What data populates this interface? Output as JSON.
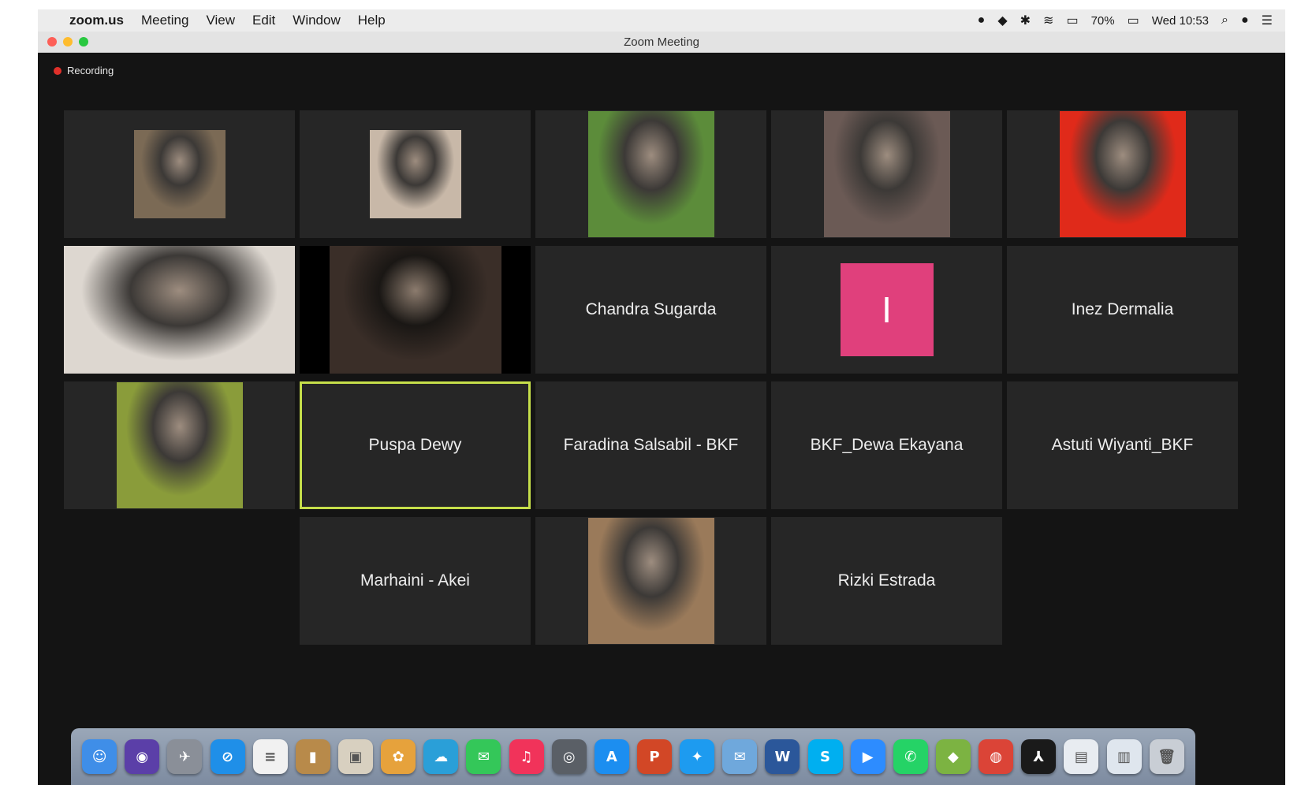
{
  "menubar": {
    "apple_icon": "apple-icon",
    "app_name": "zoom.us",
    "menus": [
      "Meeting",
      "View",
      "Edit",
      "Window",
      "Help"
    ],
    "battery": "70%",
    "clock": "Wed 10:53"
  },
  "window": {
    "title": "Zoom Meeting"
  },
  "recording": {
    "label": "Recording"
  },
  "participants": [
    {
      "name": "",
      "video": true,
      "avatar_color": "#7b6a55"
    },
    {
      "name": "",
      "video": true,
      "avatar_color": "#c8b8a8"
    },
    {
      "name": "",
      "video": true,
      "avatar_color": "#5c8c3a"
    },
    {
      "name": "",
      "video": true,
      "avatar_color": "#6b5a55"
    },
    {
      "name": "",
      "video": true,
      "avatar_color": "#e02a1a"
    },
    {
      "name": "",
      "video": true,
      "avatar_color": "#ddd7d0"
    },
    {
      "name": "",
      "video": true,
      "avatar_color": "#3a2e28"
    },
    {
      "name": "Chandra Sugarda",
      "video": false
    },
    {
      "name": "",
      "video": false,
      "initial": "I",
      "initial_color": "#e0407c"
    },
    {
      "name": "Inez Dermalia",
      "video": false
    },
    {
      "name": "",
      "video": true,
      "avatar_color": "#8a9c3a"
    },
    {
      "name": "Puspa Dewy",
      "video": false,
      "active_speaker": true
    },
    {
      "name": "Faradina Salsabil - BKF",
      "video": false
    },
    {
      "name": "BKF_Dewa Ekayana",
      "video": false
    },
    {
      "name": "Astuti Wiyanti_BKF",
      "video": false
    },
    {
      "name": "Marhaini - Akei",
      "video": false
    },
    {
      "name": "",
      "video": true,
      "avatar_color": "#9a7a5a"
    },
    {
      "name": "Rizki Estrada",
      "video": false
    }
  ],
  "dock": [
    {
      "icon": "finder-icon",
      "color": "#3f8ee8",
      "glyph": "☺"
    },
    {
      "icon": "siri-icon",
      "color": "#5b3fa8",
      "glyph": "◉"
    },
    {
      "icon": "launchpad-icon",
      "color": "#8a8f98",
      "glyph": "✈"
    },
    {
      "icon": "safari-icon",
      "color": "#1f8fe8",
      "glyph": "⊘"
    },
    {
      "icon": "notes-icon",
      "color": "#f1f1f1",
      "glyph": "≡"
    },
    {
      "icon": "notebook-icon",
      "color": "#b88a4a",
      "glyph": "▮"
    },
    {
      "icon": "preview-icon",
      "color": "#d8d0c0",
      "glyph": "▣"
    },
    {
      "icon": "photos-icon",
      "color": "#e6a23c",
      "glyph": "✿"
    },
    {
      "icon": "cloud-icon",
      "color": "#2a9fd8",
      "glyph": "☁"
    },
    {
      "icon": "messages-icon",
      "color": "#34c759",
      "glyph": "✉"
    },
    {
      "icon": "music-icon",
      "color": "#f1335a",
      "glyph": "♫"
    },
    {
      "icon": "screenshot-icon",
      "color": "#5a5f66",
      "glyph": "◎"
    },
    {
      "icon": "app-store-icon",
      "color": "#1c8ef0",
      "glyph": "A"
    },
    {
      "icon": "powerpoint-icon",
      "color": "#d24726",
      "glyph": "P"
    },
    {
      "icon": "twitter-icon",
      "color": "#1d9bf0",
      "glyph": "✦"
    },
    {
      "icon": "mail-icon",
      "color": "#6fa8dc",
      "glyph": "✉"
    },
    {
      "icon": "word-icon",
      "color": "#2b579a",
      "glyph": "W"
    },
    {
      "icon": "skype-icon",
      "color": "#00aff0",
      "glyph": "S"
    },
    {
      "icon": "zoom-icon",
      "color": "#2d8cff",
      "glyph": "▶"
    },
    {
      "icon": "whatsapp-icon",
      "color": "#25d366",
      "glyph": "✆"
    },
    {
      "icon": "android-icon",
      "color": "#7cb342",
      "glyph": "◆"
    },
    {
      "icon": "chrome-icon",
      "color": "#db4437",
      "glyph": "◍"
    },
    {
      "icon": "acrobat-icon",
      "color": "#1a1a1a",
      "glyph": "⅄"
    },
    {
      "icon": "documents-icon",
      "color": "#e8ecf1",
      "glyph": "▤"
    },
    {
      "icon": "downloads-icon",
      "color": "#dfe6ee",
      "glyph": "▥"
    },
    {
      "icon": "trash-icon",
      "color": "#c9ced5",
      "glyph": "🗑"
    }
  ]
}
